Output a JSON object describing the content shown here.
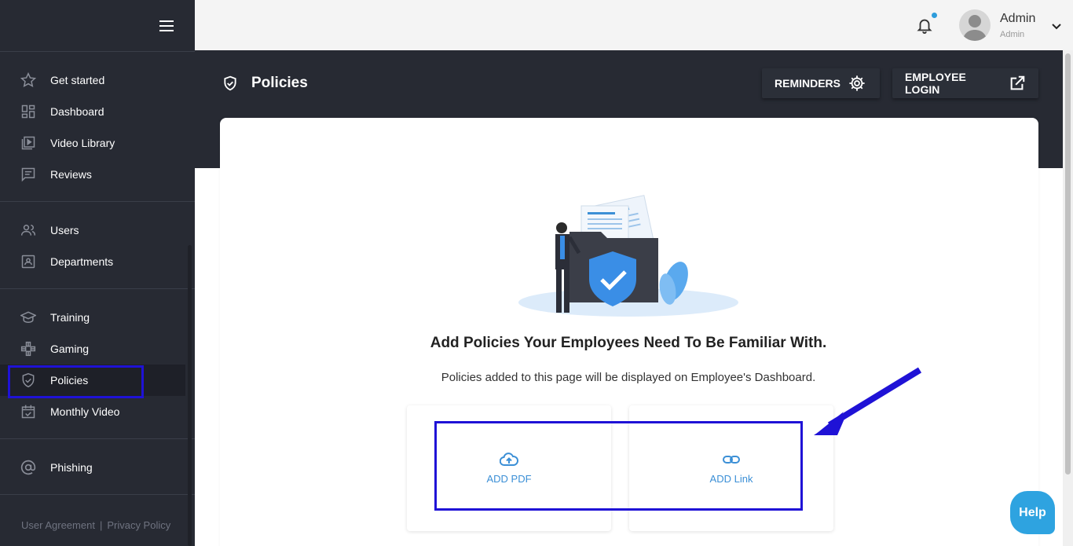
{
  "sidebar": {
    "groups": [
      [
        {
          "label": "Get started",
          "icon": "star-icon"
        },
        {
          "label": "Dashboard",
          "icon": "dashboard-icon"
        },
        {
          "label": "Video Library",
          "icon": "video-library-icon"
        },
        {
          "label": "Reviews",
          "icon": "reviews-icon"
        }
      ],
      [
        {
          "label": "Users",
          "icon": "users-icon"
        },
        {
          "label": "Departments",
          "icon": "departments-icon"
        }
      ],
      [
        {
          "label": "Training",
          "icon": "graduation-cap-icon"
        },
        {
          "label": "Gaming",
          "icon": "gamepad-icon"
        },
        {
          "label": "Policies",
          "icon": "shield-check-icon",
          "active": true
        },
        {
          "label": "Monthly Video",
          "icon": "calendar-check-icon"
        }
      ],
      [
        {
          "label": "Phishing",
          "icon": "at-sign-icon"
        }
      ]
    ],
    "footer": {
      "user_agreement": "User Agreement",
      "separator": "|",
      "privacy_policy": "Privacy Policy"
    }
  },
  "header": {
    "user_name": "Admin",
    "user_role": "Admin",
    "notification_color": "#2d9cdb"
  },
  "page": {
    "title": "Policies",
    "reminders_label": "REMINDERS",
    "employee_login_label": "EMPLOYEE LOGIN"
  },
  "main": {
    "headline": "Add Policies Your Employees Need To Be Familiar With.",
    "subline": "Policies added to this page will be displayed on Employee's Dashboard.",
    "add_pdf_label": "ADD PDF",
    "add_link_label": "ADD Link"
  },
  "help_label": "Help",
  "colors": {
    "sidebar_bg": "#272a33",
    "accent_blue": "#3b8fd6",
    "highlight": "#1f12d6",
    "help_bg": "#2ea3e0"
  }
}
